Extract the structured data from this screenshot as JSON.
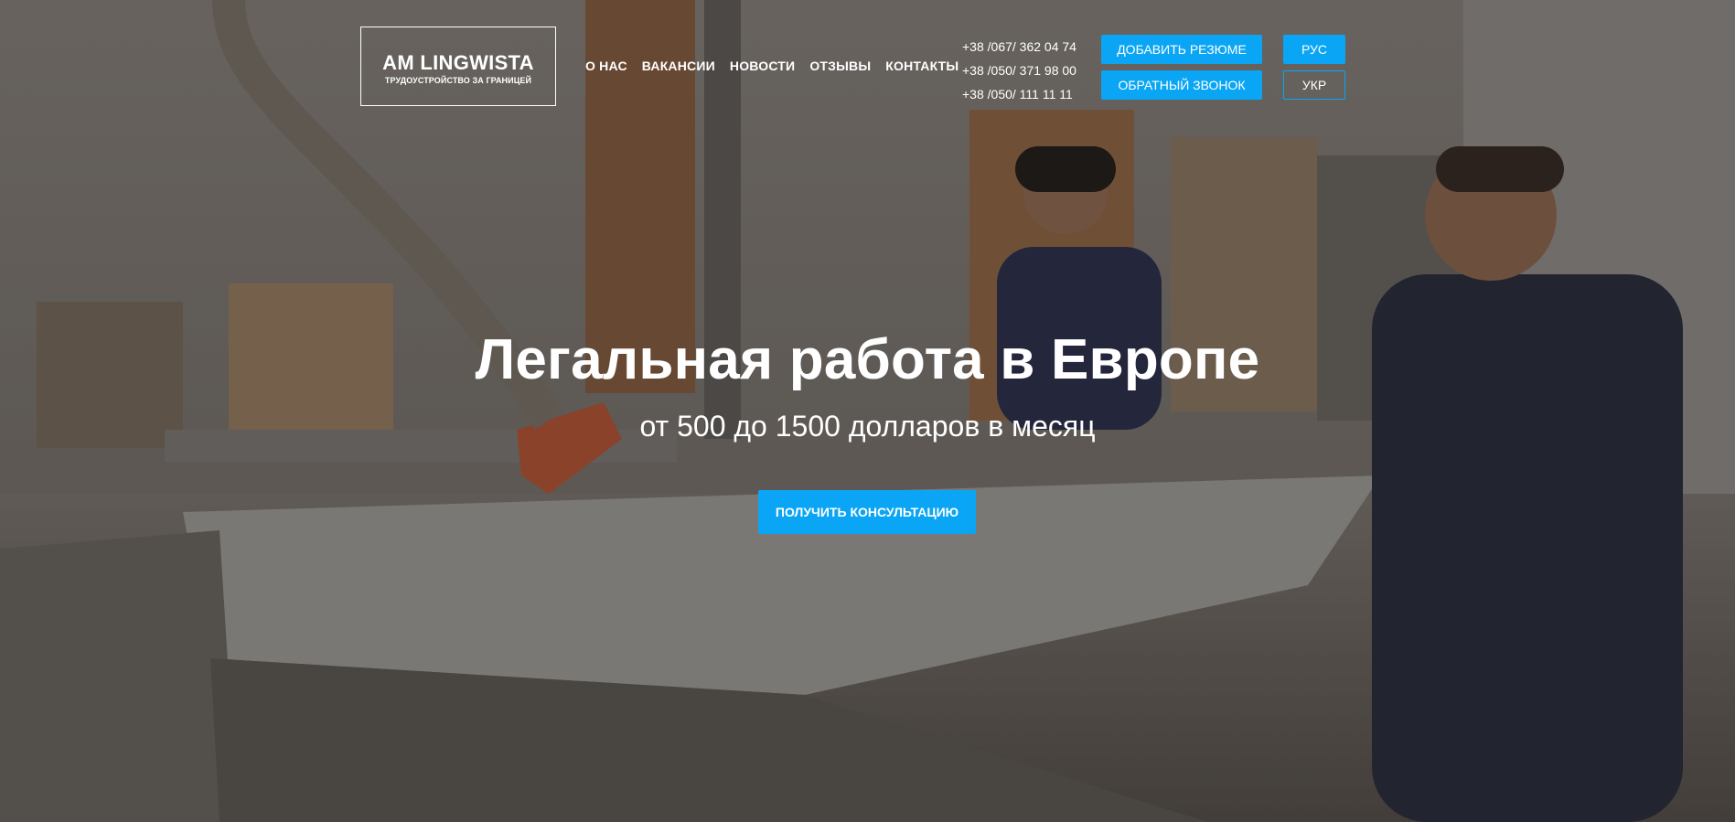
{
  "logo": {
    "title": "AM LINGWISTA",
    "subtitle": "ТРУДОУСТРОЙСТВО ЗА ГРАНИЦЕЙ"
  },
  "nav": {
    "items": [
      {
        "label": "О НАС"
      },
      {
        "label": "ВАКАНСИИ"
      },
      {
        "label": "НОВОСТИ"
      },
      {
        "label": "ОТЗЫВЫ"
      },
      {
        "label": "КОНТАКТЫ"
      }
    ]
  },
  "phones": [
    "+38 /067/ 362 04 74",
    "+38 /050/ 371 98 00",
    "+38 /050/ 111 11 11"
  ],
  "buttons": {
    "add_resume": "ДОБАВИТЬ РЕЗЮМЕ",
    "callback": "ОБРАТНЫЙ ЗВОНОК"
  },
  "languages": {
    "rus": "РУС",
    "ukr": "УКР"
  },
  "hero": {
    "headline": "Легальная работа в Европе",
    "subline": "от 500 до 1500 долларов в месяц",
    "cta": "ПОЛУЧИТЬ КОНСУЛЬТАЦИЮ"
  },
  "colors": {
    "accent": "#0aa6f5",
    "text": "#ffffff"
  }
}
